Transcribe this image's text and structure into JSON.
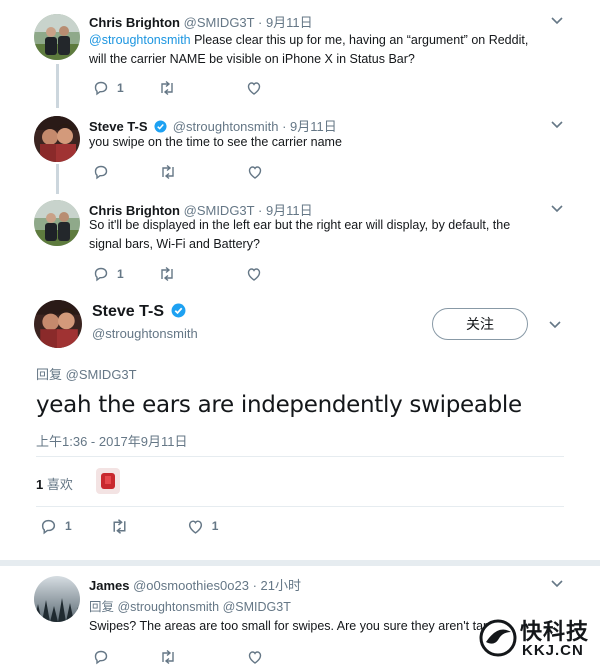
{
  "tweets": [
    {
      "name": "Chris Brighton",
      "handle": "@SMIDG3T",
      "date": "· 9月11日",
      "mention": "@stroughtonsmith",
      "text_line1": " Please clear this up for me, having an “argument” on Reddit,",
      "text_line2": "will the carrier NAME be visible on iPhone X in Status Bar?",
      "reply_count": "1",
      "retweet_count": "",
      "like_count": ""
    },
    {
      "name": "Steve T-S",
      "handle": "@stroughtonsmith",
      "date": "· 9月11日",
      "text_line1": "you swipe on the time to see the carrier name",
      "reply_count": "",
      "retweet_count": "",
      "like_count": ""
    },
    {
      "name": "Chris Brighton",
      "handle": "@SMIDG3T",
      "date": "· 9月11日",
      "text_line1": "So it'll be displayed in the left ear but the right ear will display, by default, the",
      "text_line2": "signal bars, Wi-Fi and Battery?",
      "reply_count": "1",
      "retweet_count": "",
      "like_count": ""
    }
  ],
  "focused": {
    "name": "Steve T-S",
    "handle": "@stroughtonsmith",
    "follow_label": "关注",
    "reply_to_prefix": "回复 ",
    "reply_to_handle": "@SMIDG3T",
    "text": "yeah the ears are independently swipeable",
    "timestamp": "上午1:36 - 2017年9月11日",
    "likes_count": "1",
    "likes_label": " 喜欢",
    "reply_count": "1",
    "retweet_count": "",
    "like_count": "1"
  },
  "reply": {
    "name": "James",
    "handle": "@o0smoothies0o23",
    "date": "· 21小时",
    "reply_prefix": "回复 ",
    "reply_handles": "@stroughtonsmith @SMIDG3T",
    "text": "Swipes? The areas are too small for swipes. Are you sure they aren't taps?",
    "reply_count": "",
    "retweet_count": "",
    "like_count": ""
  },
  "watermark": {
    "brand": "快科技",
    "domain": "KKJ.CN"
  },
  "colors": {
    "accent": "#1b95e0",
    "verified": "#1da1f2",
    "muted": "#657786",
    "thread_line": "#ccd6dd",
    "watermark_red": "#e8252b"
  },
  "icons": [
    "reply-icon",
    "retweet-icon",
    "like-icon",
    "chevron-down-icon",
    "verified-badge-icon"
  ]
}
